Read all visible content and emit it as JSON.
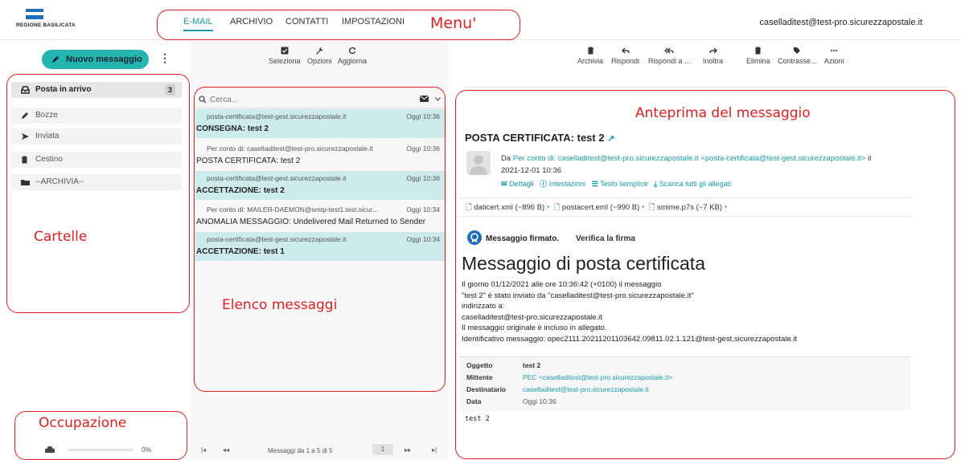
{
  "header": {
    "logo_text": "REGIONE BASILICATA",
    "nav": [
      "E-MAIL",
      "ARCHIVIO",
      "CONTATTI",
      "IMPOSTAZIONI"
    ],
    "user": "caselladitest@test-pro.sicurezzapostale.it"
  },
  "annotations": {
    "menu": "Menu'",
    "cartelle": "Cartelle",
    "elenco": "Elenco messaggi",
    "anteprima": "Anteprima del messaggio",
    "occupazione": "Occupazione"
  },
  "sidebar": {
    "new_message": "Nuovo messaggio",
    "folders": [
      {
        "label": "Posta in arrivo",
        "icon": "inbox-icon",
        "count": "3"
      },
      {
        "label": "Bozze",
        "icon": "pencil-icon"
      },
      {
        "label": "Inviata",
        "icon": "send-icon"
      },
      {
        "label": "Cestino",
        "icon": "trash-icon"
      },
      {
        "label": "--ARCHIVIA--",
        "icon": "folder-icon"
      }
    ],
    "quota_percent": "0%",
    "quota_fraction": 0
  },
  "list_toolbar": {
    "select": "Seleziona",
    "options": "Opzioni",
    "refresh": "Aggiorna"
  },
  "search": {
    "placeholder": "Cerca..."
  },
  "messages": [
    {
      "from": "posta-certificata@test-gest.sicurezzapostale.it",
      "time": "Oggi 10:36",
      "subject": "CONSEGNA: test 2",
      "bold": true,
      "highlight": true
    },
    {
      "from": "Per conto di: caselladitest@test-pro.sicurezzapostale.it",
      "time": "Oggi 10:36",
      "subject": "POSTA CERTIFICATA: test 2",
      "bold": false,
      "highlight": false
    },
    {
      "from": "posta-certificata@test-gest.sicurezzapostale.it",
      "time": "Oggi 10:36",
      "subject": "ACCETTAZIONE: test 2",
      "bold": true,
      "highlight": true
    },
    {
      "from": "Per conto di: MAILER-DAEMON@smtp-test1.test.sicur...",
      "time": "Oggi 10:34",
      "subject": "ANOMALIA MESSAGGIO: Undelivered Mail Returned to Sender",
      "bold": false,
      "highlight": false
    },
    {
      "from": "posta-certificata@test-gest.sicurezzapostale.it",
      "time": "Oggi 10:34",
      "subject": "ACCETTAZIONE: test 1",
      "bold": true,
      "highlight": true
    }
  ],
  "pager": {
    "info": "Messaggi da 1 a 5 di 5",
    "page": "1"
  },
  "reader_toolbar": [
    "Archivia",
    "Rispondi",
    "Rispondi a ...",
    "Inoltra",
    "Elimina",
    "Contrasse...",
    "Azioni"
  ],
  "preview": {
    "title": "POSTA CERTIFICATA: test 2",
    "from_prefix": "Da",
    "from_link": "Per conto di: caselladitest@test-pro.sicurezzapostale.it <posta-certificata@test-gest.sicurezzapostale.it>",
    "from_suffix": "il",
    "date": "2021-12-01 10:36",
    "actions": [
      "Dettagli",
      "Intestazioni",
      "Testo semplice",
      "Scarica tutti gli allegati"
    ],
    "attachments": [
      "daticert.xml (~896 B)",
      "postacert.eml (~990 B)",
      "smime.p7s (~7 KB)"
    ],
    "signed": "Messaggio firmato.",
    "verify": "Verifica la firma",
    "heading": "Messaggio di posta certificata",
    "body": [
      "Il giorno 01/12/2021 alle ore 10:36:42 (+0100) il messaggio",
      "\"test 2\" è stato inviato da \"caselladitest@test-pro.sicurezzapostale.it\"",
      "indirizzato a:",
      "caselladitest@test-pro.sicurezzapostale.it",
      "Il messaggio originale è incluso in allegato.",
      "Identificativo messaggio: opec2111.20211201103642.09811.02.1.121@test-gest.sicurezzapostale.it"
    ],
    "meta": [
      {
        "k": "Oggetto",
        "v": "test 2"
      },
      {
        "k": "Mittente",
        "v": "PEC <caselladitest@test-pro.sicurezzapostale.it>"
      },
      {
        "k": "Destinatario",
        "v": "caselladitest@test-pro.sicurezzapostale.it"
      },
      {
        "k": "Data",
        "v": "Oggi 10:36"
      }
    ],
    "plain": "test 2"
  }
}
